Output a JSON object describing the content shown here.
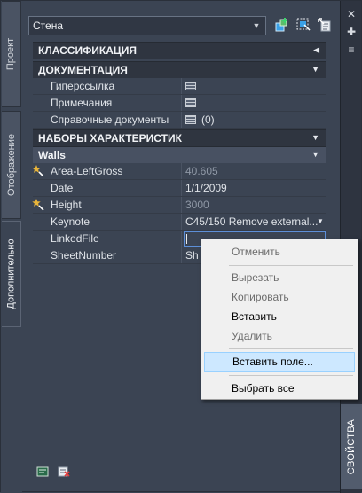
{
  "left_tabs": [
    "Проект",
    "Отображение",
    "Дополнительно"
  ],
  "right_strip": {
    "label": "СВОЙСТВА",
    "close": "✕",
    "pin": "✚",
    "menu": "≡"
  },
  "style_select": {
    "value": "Стена"
  },
  "sections": {
    "classification": "КЛАССИФИКАЦИЯ",
    "documentation": "ДОКУМЕНТАЦИЯ",
    "property_sets": "НАБОРЫ ХАРАКТЕРИСТИК",
    "walls": "Walls"
  },
  "documentation_rows": [
    {
      "name": "Гиперссылка",
      "value": ""
    },
    {
      "name": "Примечания",
      "value": ""
    },
    {
      "name": "Справочные документы",
      "value": "(0)"
    }
  ],
  "walls_rows": [
    {
      "name": "Area-LeftGross",
      "value": "40.605",
      "auto": true
    },
    {
      "name": "Date",
      "value": "1/1/2009",
      "auto": false
    },
    {
      "name": "Height",
      "value": "3000",
      "auto": true
    },
    {
      "name": "Keynote",
      "value": "C45/150 Remove external...",
      "auto": false
    },
    {
      "name": "LinkedFile",
      "value": "",
      "auto": false
    },
    {
      "name": "SheetNumber",
      "value": "Sh",
      "auto": false
    }
  ],
  "context_menu": {
    "items": [
      {
        "label": "Отменить",
        "enabled": false
      },
      {
        "label": "Вырезать",
        "enabled": false
      },
      {
        "label": "Копировать",
        "enabled": false
      },
      {
        "label": "Вставить",
        "enabled": true
      },
      {
        "label": "Удалить",
        "enabled": false
      },
      {
        "label": "Вставить поле...",
        "enabled": true,
        "highlighted": true
      },
      {
        "label": "Выбрать все",
        "enabled": true
      }
    ]
  },
  "colors": {
    "panel_bg": "#3b4453",
    "section_bg": "#2f3540",
    "accent_green": "#36c26a",
    "auto_star": "#e8b43a",
    "menu_highlight": "#cde8ff"
  }
}
